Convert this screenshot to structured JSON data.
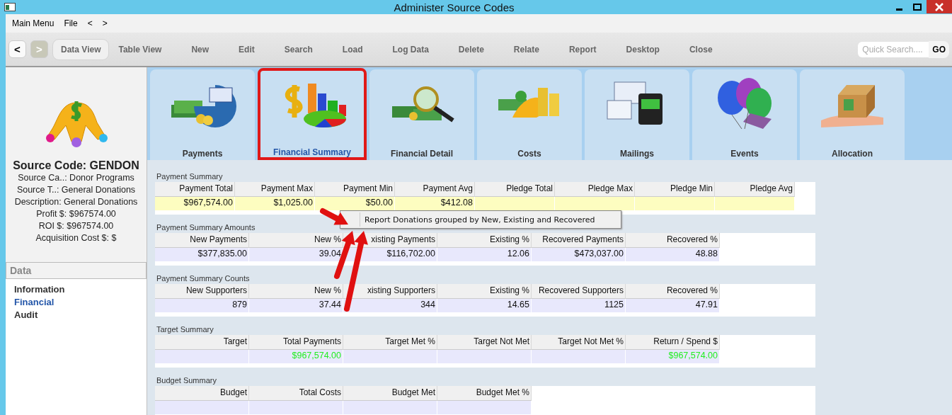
{
  "window": {
    "title": "Administer Source Codes"
  },
  "menu": [
    "Main Menu",
    "File",
    "<",
    ">"
  ],
  "toolbar": {
    "nav": [
      {
        "label": "<",
        "disabled": false
      },
      {
        "label": ">",
        "disabled": true
      }
    ],
    "items": [
      {
        "label": "Data View",
        "selected": true
      },
      {
        "label": "Table View",
        "selected": false
      },
      {
        "label": "New",
        "selected": false
      },
      {
        "label": "Edit",
        "selected": false
      },
      {
        "label": "Search",
        "selected": false
      },
      {
        "label": "Load",
        "selected": false
      },
      {
        "label": "Log Data",
        "selected": false
      },
      {
        "label": "Delete",
        "selected": false
      },
      {
        "label": "Relate",
        "selected": false
      },
      {
        "label": "Report",
        "selected": false
      },
      {
        "label": "Desktop",
        "selected": false
      },
      {
        "label": "Close",
        "selected": false
      }
    ],
    "search": {
      "placeholder": "Quick Search....",
      "button": "GO"
    }
  },
  "sidebar": {
    "title": "Source Code: GENDON",
    "details": [
      "Source Ca..: Donor Programs",
      "Source T..: General Donations",
      "Description: General Donations",
      "Profit $: $967574.00",
      "ROI $: $967574.00",
      "Acquisition Cost $: $"
    ],
    "section": "Data",
    "items": [
      {
        "label": "Information",
        "selected": false
      },
      {
        "label": "Financial",
        "selected": true
      },
      {
        "label": "Audit",
        "selected": false
      }
    ]
  },
  "tabs": [
    {
      "label": "Payments",
      "kind": "payments",
      "selected": false
    },
    {
      "label": "Financial Summary",
      "kind": "chart",
      "selected": true
    },
    {
      "label": "Financial Detail",
      "kind": "magnifier",
      "selected": false
    },
    {
      "label": "Costs",
      "kind": "coins",
      "selected": false
    },
    {
      "label": "Mailings",
      "kind": "mail",
      "selected": false
    },
    {
      "label": "Events",
      "kind": "balloons",
      "selected": false
    },
    {
      "label": "Allocation",
      "kind": "box",
      "selected": false
    }
  ],
  "sections": [
    {
      "title": "Payment Summary",
      "highlighted": true,
      "columns": [
        {
          "header": "Payment Total",
          "value": "$967,574.00"
        },
        {
          "header": "Payment Max",
          "value": "$1,025.00"
        },
        {
          "header": "Payment Min",
          "value": "$50.00"
        },
        {
          "header": "Payment Avg",
          "value": "$412.08"
        },
        {
          "header": "Pledge Total"
        },
        {
          "header": "Pledge Max"
        },
        {
          "header": "Pledge Min"
        },
        {
          "header": "Pledge Avg"
        }
      ]
    },
    {
      "title": "Payment Summary Amounts",
      "highlighted": false,
      "columns": [
        {
          "header": "New Payments",
          "value": "$377,835.00"
        },
        {
          "header": "New %",
          "value": "39.04"
        },
        {
          "header": "xisting Payments",
          "value": "$116,702.00"
        },
        {
          "header": "Existing %",
          "value": "12.06"
        },
        {
          "header": "Recovered Payments",
          "value": "$473,037.00"
        },
        {
          "header": "Recovered %",
          "value": "48.88"
        }
      ]
    },
    {
      "title": "Payment Summary Counts",
      "highlighted": false,
      "columns": [
        {
          "header": "New Supporters",
          "value": "879"
        },
        {
          "header": "New %",
          "value": "37.44"
        },
        {
          "header": "xisting Supporters",
          "value": "344"
        },
        {
          "header": "Existing %",
          "value": "14.65"
        },
        {
          "header": "Recovered Supporters",
          "value": "1125"
        },
        {
          "header": "Recovered %",
          "value": "47.91"
        }
      ]
    },
    {
      "title": "Target Summary",
      "highlighted": false,
      "columns": [
        {
          "header": "Target"
        },
        {
          "header": "Total Payments",
          "value": "$967,574.00",
          "color": "#22ee22"
        },
        {
          "header": "Target Met %"
        },
        {
          "header": "Target Not Met"
        },
        {
          "header": "Target Not Met %"
        },
        {
          "header": "Return / Spend $",
          "value": "$967,574.00",
          "color": "#22ee22"
        }
      ]
    },
    {
      "title": "Budget Summary",
      "highlighted": false,
      "columns": [
        {
          "header": "Budget"
        },
        {
          "header": "Total Costs"
        },
        {
          "header": "Budget Met"
        },
        {
          "header": "Budget Met %"
        }
      ]
    }
  ],
  "tooltip": {
    "text": "Report Donations grouped by New, Existing and Recovered"
  }
}
